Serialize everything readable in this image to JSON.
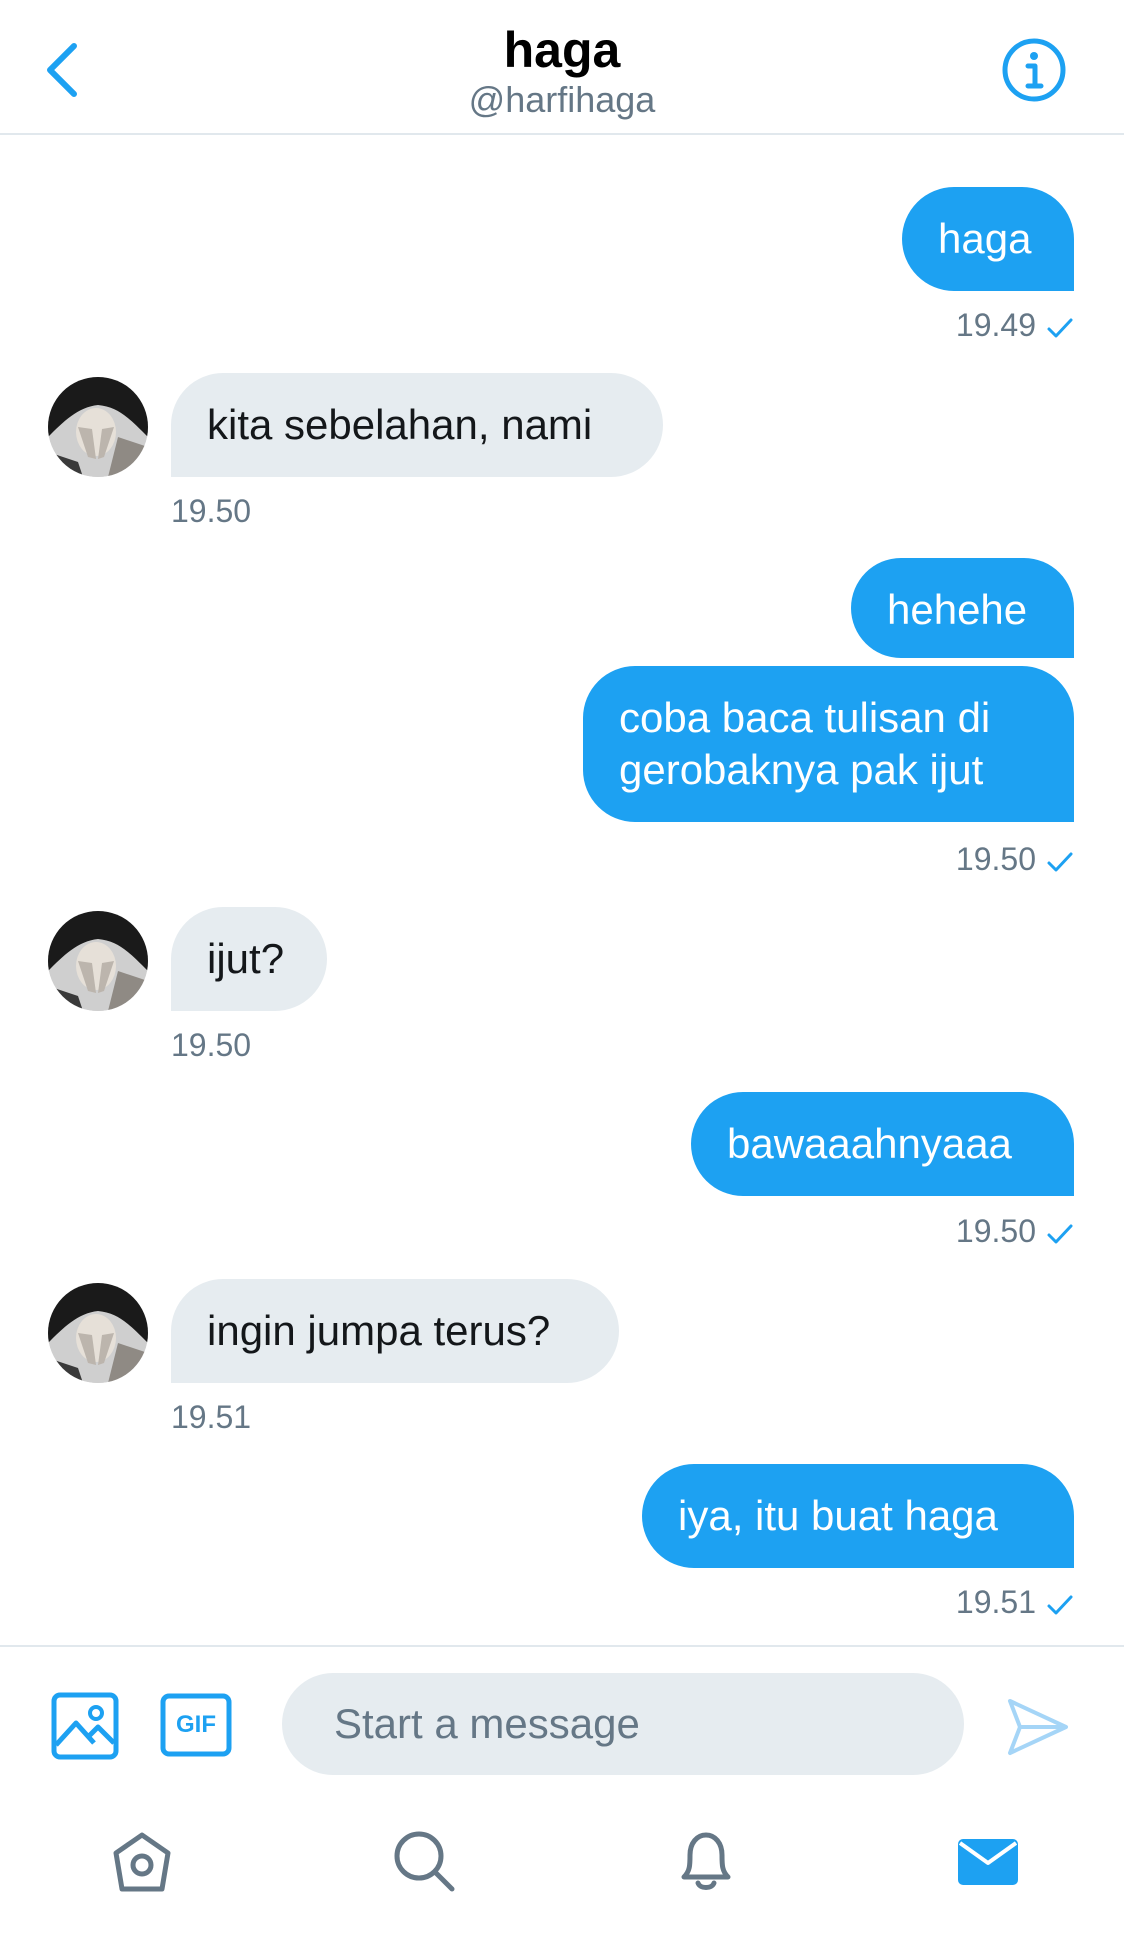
{
  "header": {
    "name": "haga",
    "handle": "@harfihaga"
  },
  "messages": [
    {
      "direction": "out",
      "text": "haga",
      "time": "19.49"
    },
    {
      "direction": "in",
      "text": "kita sebelahan, nami",
      "time": "19.50"
    },
    {
      "direction": "out",
      "text": "hehehe"
    },
    {
      "direction": "out",
      "text": "coba baca tulisan di gerobaknya pak ijut",
      "line1": "coba baca tulisan di",
      "line2": "gerobaknya pak ijut",
      "time": "19.50"
    },
    {
      "direction": "in",
      "text": "ijut?",
      "time": "19.50"
    },
    {
      "direction": "out",
      "text": "bawaaahnyaaa",
      "time": "19.50"
    },
    {
      "direction": "in",
      "text": "ingin jumpa terus?",
      "time": "19.51"
    },
    {
      "direction": "out",
      "text": "iya, itu buat haga",
      "time": "19.51"
    }
  ],
  "composer": {
    "placeholder": "Start a message",
    "gif_label": "GIF"
  },
  "tabs": [
    "home-tab",
    "search-tab",
    "notifications-tab",
    "messages-tab"
  ],
  "colors": {
    "accent": "#1da1f2",
    "incoming_bubble": "#e6ecf0",
    "meta_text": "#657786"
  },
  "icons": [
    "back-chevron-icon",
    "info-icon",
    "image-icon",
    "gif-icon",
    "send-icon",
    "home-icon",
    "search-icon",
    "bell-icon",
    "envelope-icon",
    "read-check-icon"
  ]
}
